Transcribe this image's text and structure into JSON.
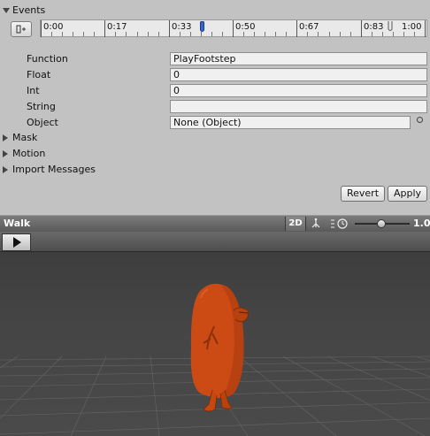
{
  "events": {
    "section_label": "Events",
    "timeline": {
      "ticks": [
        "0:00",
        "0:17",
        "0:33",
        "0:50",
        "0:67",
        "0:83",
        "1:00"
      ],
      "selected_event_time": 0.42,
      "playhead_time": 0.91
    },
    "fields": [
      {
        "label": "Function",
        "value": "PlayFootstep"
      },
      {
        "label": "Float",
        "value": "0"
      },
      {
        "label": "Int",
        "value": "0"
      },
      {
        "label": "String",
        "value": ""
      },
      {
        "label": "Object",
        "value": "None (Object)"
      }
    ]
  },
  "foldouts": {
    "mask": "Mask",
    "motion": "Motion",
    "import_messages": "Import Messages"
  },
  "buttons": {
    "revert": "Revert",
    "apply": "Apply"
  },
  "preview": {
    "clip_name": "Walk",
    "mode_2d": "2D",
    "speed_value": "1.0",
    "speed_slider_fraction": 0.48
  },
  "colors": {
    "event_marker": "#3a66c8",
    "character": "#cc4b14"
  }
}
